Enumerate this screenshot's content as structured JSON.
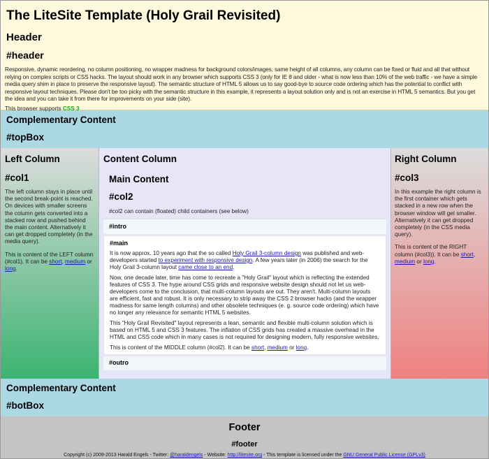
{
  "header": {
    "title": "The LiteSite Template (Holy Grail Revisited)",
    "subtitle": "Header",
    "id": "#header",
    "description": "Responsive, dynamic reordering, no column positioning, no wrapper madness for background colors/images, same height of all columns, any column can be fixed or fluid and all that without relying on complex scripts or CSS hacks. The layout should work in any browser which supports CSS 3 (only for IE 8 and older - what is now less than 10% of the web traffic - we have a simple media query shim in place to preserve the responsive layout). The semantic structure of HTML 5 allows us to say good-bye to source code ordering which has the potential to conflict with responsive layout techniques. Please don't be too picky with the semantic structure in this example, it represents a layout solution only and is not an exercise in HTML 5 semantics. But you get the idea and you can take it from there for improvements on your side (site).",
    "support_prefix": "This browser supports",
    "support_value": "CSS 3"
  },
  "topbox": {
    "title": "Complementary Content",
    "id": "#topBox"
  },
  "left": {
    "title": "Left Column",
    "id": "#col1",
    "text": "The left column stays in place until the second break-point is reached. On devices with smaller screens the column gets converted into a stacked row and pushed behind the main content. Alternatively it can get dropped completely (in the media query).",
    "content_prefix": "This is content of the LEFT column (#col1). It can be",
    "link_short": "short",
    "sep": ",",
    "link_medium": "medium",
    "or": "or",
    "link_long": "long",
    "end": "."
  },
  "content": {
    "title": "Content Column",
    "main_title": "Main Content",
    "main_id": "#col2",
    "note": "#col2 can contain (floated) child containers (see below)",
    "intro": "#intro",
    "main": "#main",
    "outro": "#outro",
    "p1_a": "It is now approx. 10 years ago that the so called",
    "p1_link1": "Holy Grail 3-column design",
    "p1_b": "was published and web-developers started",
    "p1_link2": "to experiment with responsive design",
    "p1_c": ". A few years later (in 2006) the search for the Holy Grail 3-column layout",
    "p1_link3": "came close to an end",
    "p1_d": ".",
    "p2": "Now, one decade later, time has come to recreate a \"Holy Grail\" layout which is reflecting the extended features of CSS 3. The hype around CSS grids and responsive website design should not let us web-developers come to the conclusion, that multi-column layouts are out. They aren't. Multi-column layouts are efficient, fast and robust. It is only necessary to strip away the CSS 2 browser hacks (and the wrapper madness for same length columns) and other obsolete techniques (e. g. source code ordering) which have no longer any relevance for semantic HTML 5 websites.",
    "p3": "This \"Holy Grail Revisited\" layout represents a lean, semantic and flexible multi-column solution which is based on HTML 5 and CSS 3 features. The inflation of CSS grids has created a massive overhead in the HTML and CSS code which in many cases is not required for designing modern, fully responsive websites.",
    "p4_prefix": "This is content of the MIDDLE column (#col2). It can be",
    "link_short": "short",
    "link_medium": "medium",
    "link_long": "long"
  },
  "right": {
    "title": "Right Column",
    "id": "#col3",
    "text": "In this example the right column is the first container which gets stacked in a new row when the browser window will get smaller. Alternatively it can get dropped completely (in the CSS media query).",
    "content_prefix": "This is content of the RIGHT column (#col3)). It can be",
    "link_short": "short",
    "link_medium": "medium",
    "link_long": "long"
  },
  "botbox": {
    "title": "Complementary Content",
    "id": "#botBox"
  },
  "footer": {
    "title": "Footer",
    "id": "#footer",
    "copy_a": "Copyright (c) 2009-2013 Harald Engels - Twitter:",
    "twitter": "@haraldengels",
    "copy_b": "- Website:",
    "website": "http://litesite.org",
    "copy_c": "- This template is licensed under the",
    "license": "GNU General Public License (GPLv3)"
  }
}
